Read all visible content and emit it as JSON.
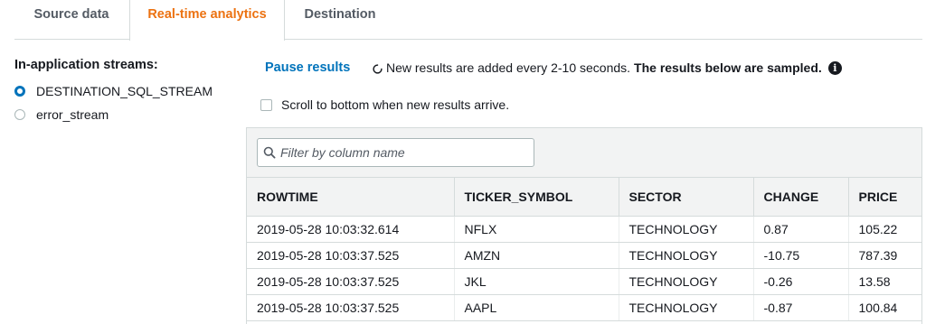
{
  "tabs": [
    {
      "label": "Source data",
      "active": false
    },
    {
      "label": "Real-time analytics",
      "active": true
    },
    {
      "label": "Destination",
      "active": false
    }
  ],
  "sidebar": {
    "title": "In-application streams:",
    "streams": [
      {
        "label": "DESTINATION_SQL_STREAM",
        "selected": true
      },
      {
        "label": "error_stream",
        "selected": false
      }
    ]
  },
  "controls": {
    "pause_label": "Pause results",
    "refresh_text": "New results are added every 2-10 seconds.",
    "sampled_text": "The results below are sampled.",
    "info_icon": "i",
    "scroll_checkbox_label": "Scroll to bottom when new results arrive.",
    "scroll_checked": false
  },
  "filter": {
    "placeholder": "Filter by column name",
    "value": ""
  },
  "table": {
    "columns": [
      "ROWTIME",
      "TICKER_SYMBOL",
      "SECTOR",
      "CHANGE",
      "PRICE"
    ],
    "rows": [
      [
        "2019-05-28 10:03:32.614",
        "NFLX",
        "TECHNOLOGY",
        "0.87",
        "105.22"
      ],
      [
        "2019-05-28 10:03:37.525",
        "AMZN",
        "TECHNOLOGY",
        "-10.75",
        "787.39"
      ],
      [
        "2019-05-28 10:03:37.525",
        "JKL",
        "TECHNOLOGY",
        "-0.26",
        "13.58"
      ],
      [
        "2019-05-28 10:03:37.525",
        "AAPL",
        "TECHNOLOGY",
        "-0.87",
        "100.84"
      ]
    ]
  },
  "colors": {
    "accent": "#ec7211",
    "link": "#0073bb",
    "border": "#d5dbdb",
    "header_bg": "#f2f3f3"
  }
}
